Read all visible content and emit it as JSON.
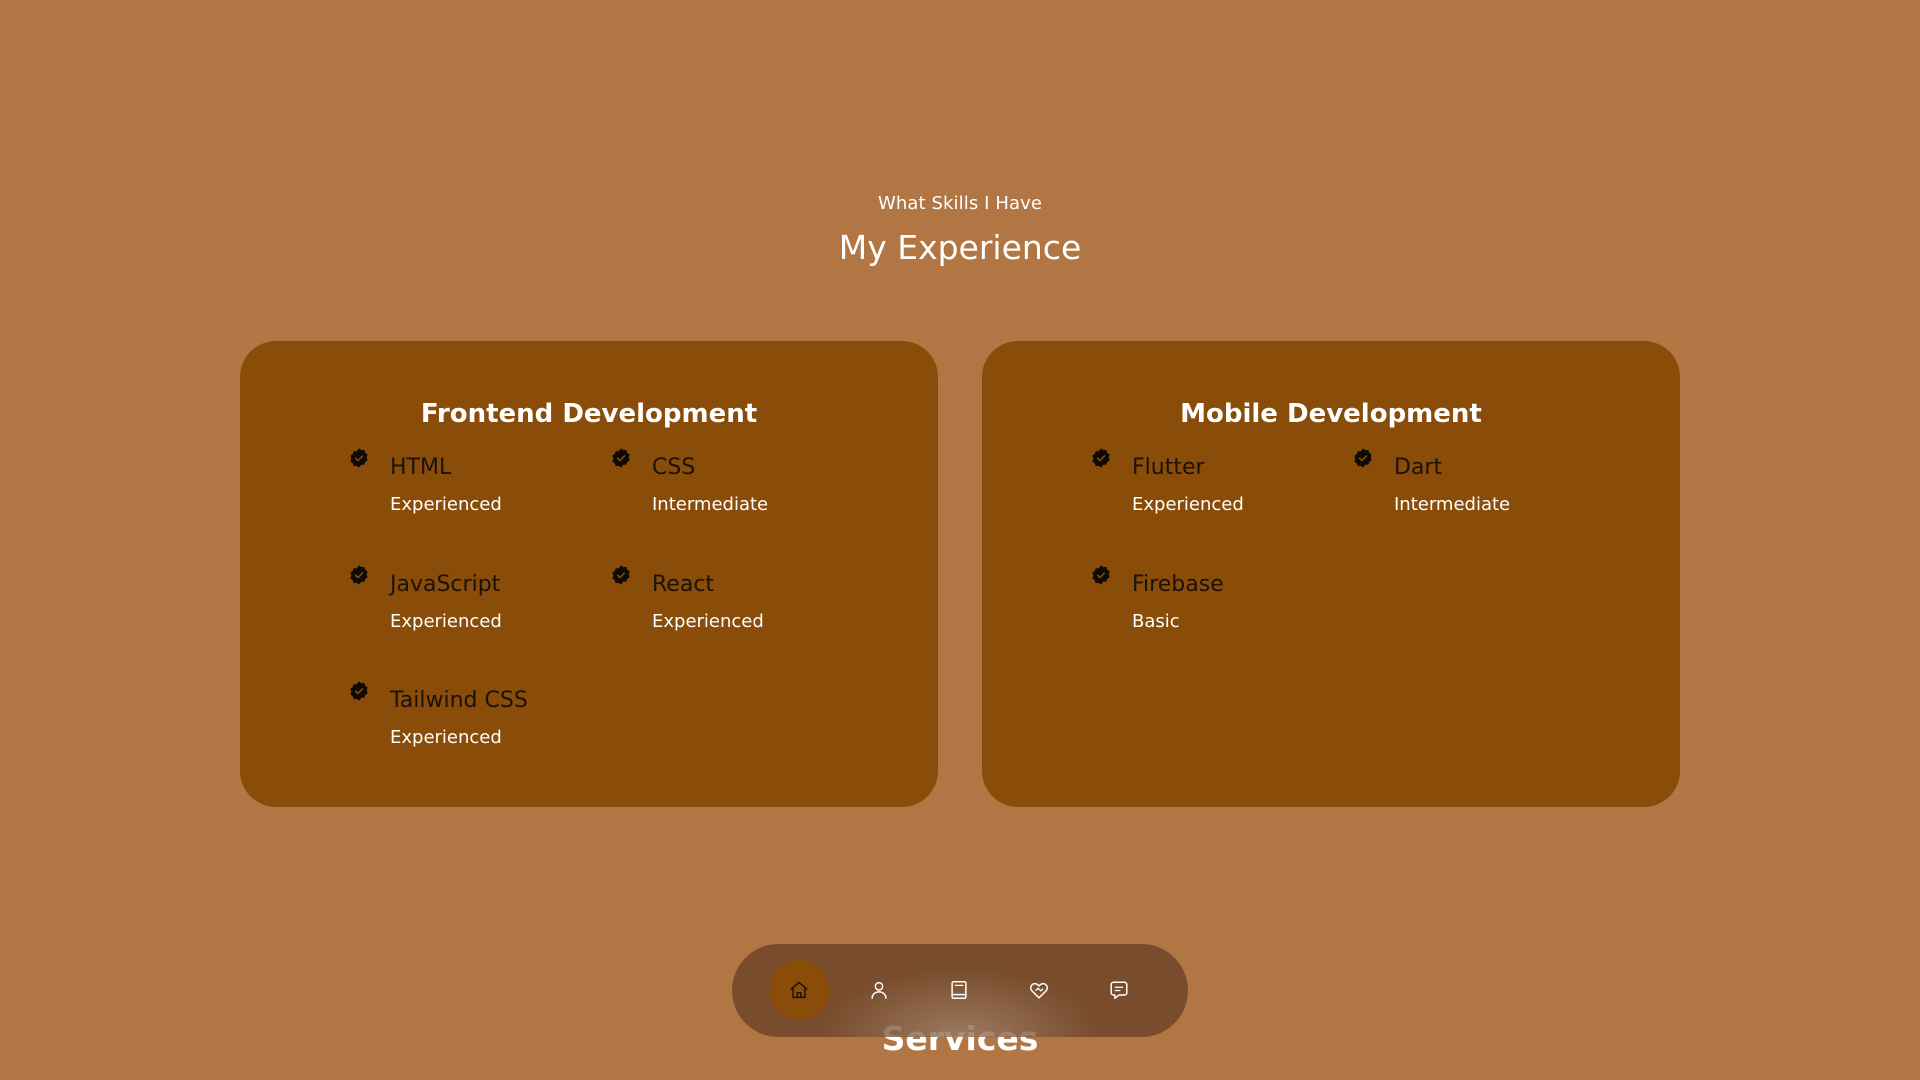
{
  "section": {
    "eyebrow": "What Skills I Have",
    "title": "My Experience"
  },
  "cards": [
    {
      "title": "Frontend Development",
      "skills": [
        {
          "name": "HTML",
          "level": "Experienced"
        },
        {
          "name": "CSS",
          "level": "Intermediate"
        },
        {
          "name": "JavaScript",
          "level": "Experienced"
        },
        {
          "name": "React",
          "level": "Experienced"
        },
        {
          "name": "Tailwind CSS",
          "level": "Experienced"
        }
      ]
    },
    {
      "title": "Mobile Development",
      "skills": [
        {
          "name": "Flutter",
          "level": "Experienced"
        },
        {
          "name": "Dart",
          "level": "Intermediate"
        },
        {
          "name": "Firebase",
          "level": "Basic"
        }
      ]
    }
  ],
  "next_section_title": "Services",
  "nav": {
    "items": [
      {
        "icon": "home-icon",
        "active": true
      },
      {
        "icon": "user-icon",
        "active": false
      },
      {
        "icon": "book-icon",
        "active": false
      },
      {
        "icon": "handshake-icon",
        "active": false
      },
      {
        "icon": "message-icon",
        "active": false
      }
    ]
  },
  "colors": {
    "page_background": "#b17643",
    "card_background": "#894c09",
    "nav_background": "#684026",
    "nav_active": "#894c09",
    "badge": "#0f0a05"
  }
}
